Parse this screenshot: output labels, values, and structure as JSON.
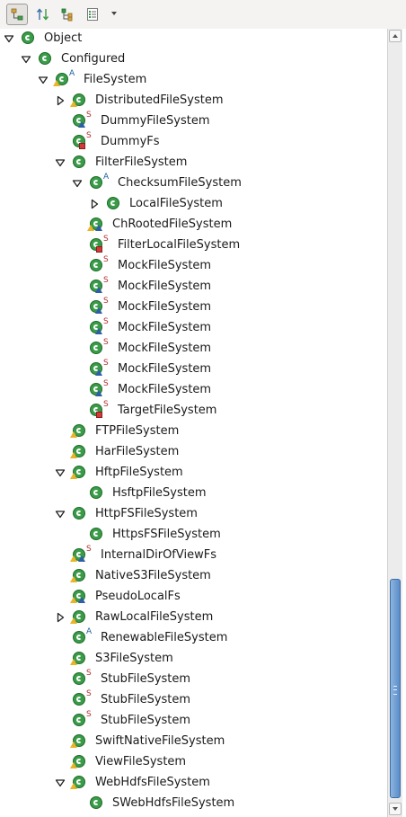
{
  "toolbar": {
    "buttons": [
      {
        "name": "show-hierarchy-button",
        "icon": "type-hierarchy-icon",
        "active": true
      },
      {
        "name": "show-supertype-button",
        "icon": "supertype-hierarchy-icon",
        "active": false
      },
      {
        "name": "show-subtype-button",
        "icon": "subtype-hierarchy-icon",
        "active": false
      },
      {
        "name": "history-button",
        "icon": "history-list-icon",
        "active": false
      }
    ],
    "menu_icon": "chevron-down-icon"
  },
  "tree": {
    "rows": [
      {
        "label": "Object",
        "depth": 0,
        "expanded": true,
        "hasChildren": true,
        "mod": "",
        "overlay": ""
      },
      {
        "label": "Configured",
        "depth": 1,
        "expanded": true,
        "hasChildren": true,
        "mod": "",
        "overlay": ""
      },
      {
        "label": "FileSystem",
        "depth": 2,
        "expanded": true,
        "hasChildren": true,
        "mod": "A",
        "overlay": "warn"
      },
      {
        "label": "DistributedFileSystem",
        "depth": 3,
        "expanded": false,
        "hasChildren": true,
        "mod": "",
        "overlay": "warn"
      },
      {
        "label": "DummyFileSystem",
        "depth": 3,
        "expanded": false,
        "hasChildren": false,
        "mod": "S",
        "overlay": "blue"
      },
      {
        "label": "DummyFs",
        "depth": 3,
        "expanded": false,
        "hasChildren": false,
        "mod": "S",
        "overlay": "red"
      },
      {
        "label": "FilterFileSystem",
        "depth": 3,
        "expanded": true,
        "hasChildren": true,
        "mod": "",
        "overlay": ""
      },
      {
        "label": "ChecksumFileSystem",
        "depth": 4,
        "expanded": true,
        "hasChildren": true,
        "mod": "A",
        "overlay": ""
      },
      {
        "label": "LocalFileSystem",
        "depth": 5,
        "expanded": false,
        "hasChildren": true,
        "mod": "",
        "overlay": ""
      },
      {
        "label": "ChRootedFileSystem",
        "depth": 4,
        "expanded": false,
        "hasChildren": false,
        "mod": "",
        "overlay": "warnblue"
      },
      {
        "label": "FilterLocalFileSystem",
        "depth": 4,
        "expanded": false,
        "hasChildren": false,
        "mod": "S",
        "overlay": "red"
      },
      {
        "label": "MockFileSystem",
        "depth": 4,
        "expanded": false,
        "hasChildren": false,
        "mod": "S",
        "overlay": ""
      },
      {
        "label": "MockFileSystem",
        "depth": 4,
        "expanded": false,
        "hasChildren": false,
        "mod": "S",
        "overlay": "blue"
      },
      {
        "label": "MockFileSystem",
        "depth": 4,
        "expanded": false,
        "hasChildren": false,
        "mod": "S",
        "overlay": "blue"
      },
      {
        "label": "MockFileSystem",
        "depth": 4,
        "expanded": false,
        "hasChildren": false,
        "mod": "S",
        "overlay": "blue"
      },
      {
        "label": "MockFileSystem",
        "depth": 4,
        "expanded": false,
        "hasChildren": false,
        "mod": "S",
        "overlay": ""
      },
      {
        "label": "MockFileSystem",
        "depth": 4,
        "expanded": false,
        "hasChildren": false,
        "mod": "S",
        "overlay": "blue"
      },
      {
        "label": "MockFileSystem",
        "depth": 4,
        "expanded": false,
        "hasChildren": false,
        "mod": "S",
        "overlay": "blue"
      },
      {
        "label": "TargetFileSystem",
        "depth": 4,
        "expanded": false,
        "hasChildren": false,
        "mod": "S",
        "overlay": "red"
      },
      {
        "label": "FTPFileSystem",
        "depth": 3,
        "expanded": false,
        "hasChildren": false,
        "mod": "",
        "overlay": "warn"
      },
      {
        "label": "HarFileSystem",
        "depth": 3,
        "expanded": false,
        "hasChildren": false,
        "mod": "",
        "overlay": "warn"
      },
      {
        "label": "HftpFileSystem",
        "depth": 3,
        "expanded": true,
        "hasChildren": true,
        "mod": "",
        "overlay": "warn"
      },
      {
        "label": "HsftpFileSystem",
        "depth": 4,
        "expanded": false,
        "hasChildren": false,
        "mod": "",
        "overlay": ""
      },
      {
        "label": "HttpFSFileSystem",
        "depth": 3,
        "expanded": true,
        "hasChildren": true,
        "mod": "",
        "overlay": ""
      },
      {
        "label": "HttpsFSFileSystem",
        "depth": 4,
        "expanded": false,
        "hasChildren": false,
        "mod": "",
        "overlay": ""
      },
      {
        "label": "InternalDirOfViewFs",
        "depth": 3,
        "expanded": false,
        "hasChildren": false,
        "mod": "S",
        "overlay": "warnblue"
      },
      {
        "label": "NativeS3FileSystem",
        "depth": 3,
        "expanded": false,
        "hasChildren": false,
        "mod": "",
        "overlay": "warn"
      },
      {
        "label": "PseudoLocalFs",
        "depth": 3,
        "expanded": false,
        "hasChildren": false,
        "mod": "",
        "overlay": "warnblue"
      },
      {
        "label": "RawLocalFileSystem",
        "depth": 3,
        "expanded": false,
        "hasChildren": true,
        "mod": "",
        "overlay": "warn"
      },
      {
        "label": "RenewableFileSystem",
        "depth": 3,
        "expanded": false,
        "hasChildren": false,
        "mod": "A",
        "overlay": ""
      },
      {
        "label": "S3FileSystem",
        "depth": 3,
        "expanded": false,
        "hasChildren": false,
        "mod": "",
        "overlay": "warn"
      },
      {
        "label": "StubFileSystem",
        "depth": 3,
        "expanded": false,
        "hasChildren": false,
        "mod": "S",
        "overlay": ""
      },
      {
        "label": "StubFileSystem",
        "depth": 3,
        "expanded": false,
        "hasChildren": false,
        "mod": "S",
        "overlay": ""
      },
      {
        "label": "StubFileSystem",
        "depth": 3,
        "expanded": false,
        "hasChildren": false,
        "mod": "S",
        "overlay": ""
      },
      {
        "label": "SwiftNativeFileSystem",
        "depth": 3,
        "expanded": false,
        "hasChildren": false,
        "mod": "",
        "overlay": "warn"
      },
      {
        "label": "ViewFileSystem",
        "depth": 3,
        "expanded": false,
        "hasChildren": false,
        "mod": "",
        "overlay": "warn"
      },
      {
        "label": "WebHdfsFileSystem",
        "depth": 3,
        "expanded": true,
        "hasChildren": true,
        "mod": "",
        "overlay": "warn"
      },
      {
        "label": "SWebHdfsFileSystem",
        "depth": 4,
        "expanded": false,
        "hasChildren": false,
        "mod": "",
        "overlay": ""
      }
    ]
  },
  "scrollbar": {
    "position_fraction": 0.7,
    "visible_fraction": 0.28
  }
}
